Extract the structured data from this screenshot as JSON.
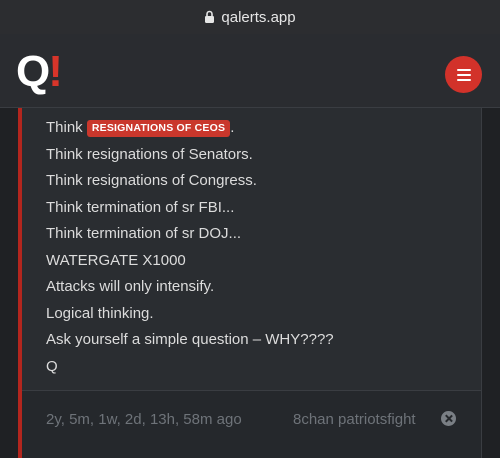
{
  "browser": {
    "url": "qalerts.app",
    "lock_icon": "lock-icon"
  },
  "header": {
    "logo_q": "Q",
    "logo_bang": "!",
    "menu_icon": "hamburger-menu-icon",
    "accent_color": "#d2322a"
  },
  "post": {
    "first_line_prefix": "Think",
    "tag_label": "RESIGNATIONS OF CEOS",
    "first_line_suffix": ".",
    "lines": [
      "Think resignations of Senators.",
      "Think resignations of Congress.",
      "Think termination of sr FBI...",
      "Think termination of sr DOJ...",
      "WATERGATE X1000",
      "Attacks will only intensify.",
      "Logical thinking.",
      "Ask yourself a simple question – WHY????",
      "Q"
    ],
    "timestamp": "2y, 5m, 1w, 2d, 13h, 58m ago",
    "source": "8chan patriotsfight",
    "source_icon": "close-circle-icon"
  }
}
